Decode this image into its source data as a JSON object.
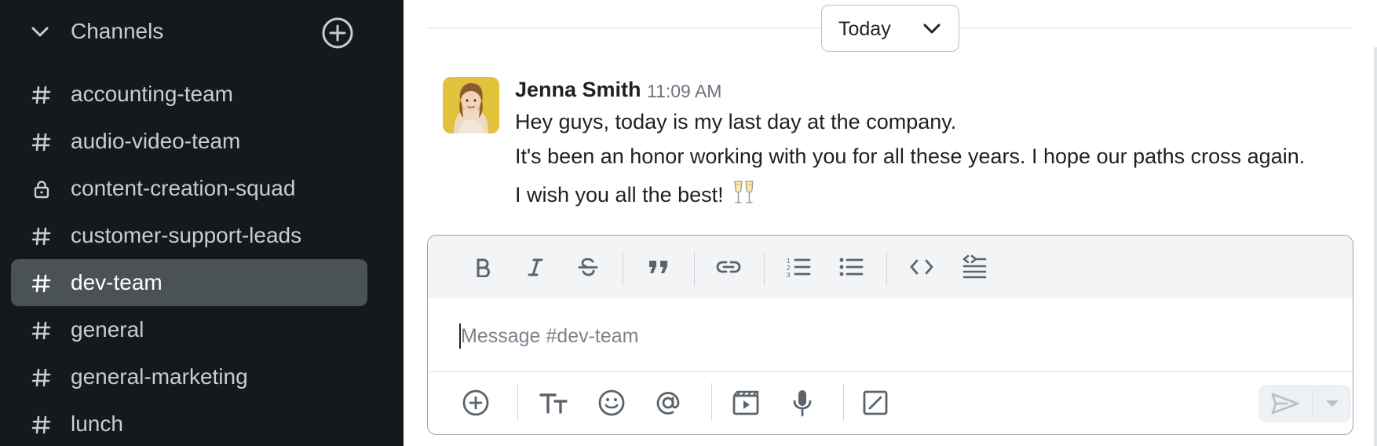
{
  "sidebar": {
    "section_title": "Channels",
    "channels": [
      {
        "label": "accounting-team",
        "icon": "hash-icon",
        "active": false
      },
      {
        "label": "audio-video-team",
        "icon": "hash-icon",
        "active": false
      },
      {
        "label": "content-creation-squad",
        "icon": "lock-icon",
        "active": false
      },
      {
        "label": "customer-support-leads",
        "icon": "hash-icon",
        "active": false
      },
      {
        "label": "dev-team",
        "icon": "hash-icon",
        "active": true
      },
      {
        "label": "general",
        "icon": "hash-icon",
        "active": false
      },
      {
        "label": "general-marketing",
        "icon": "hash-icon",
        "active": false
      },
      {
        "label": "lunch",
        "icon": "hash-icon",
        "active": false
      }
    ]
  },
  "main": {
    "date_divider": "Today",
    "message": {
      "author": "Jenna Smith",
      "time": "11:09 AM",
      "lines": [
        "Hey guys, today is my last day at the company.",
        "It's been an honor working with you for all these years. I hope our paths cross again.",
        "I wish you all the best!"
      ],
      "emoji": "clinking-glasses-icon"
    },
    "composer": {
      "placeholder": "Message #dev-team",
      "value": "",
      "formatting_tools": [
        "bold-icon",
        "italic-icon",
        "strikethrough-icon",
        "quote-icon",
        "link-icon",
        "ordered-list-icon",
        "bulleted-list-icon",
        "code-icon",
        "code-block-icon"
      ],
      "actions": [
        "add-icon",
        "text-format-icon",
        "emoji-icon",
        "mention-icon",
        "video-icon",
        "microphone-icon",
        "slash-command-icon"
      ]
    }
  },
  "colors": {
    "sidebar_bg": "#14191d",
    "active_item_bg": "#4b5256",
    "sidebar_text": "#c9cdd1",
    "composer_border": "#98a5b3",
    "toolbar_bg": "#f2f4f6"
  }
}
